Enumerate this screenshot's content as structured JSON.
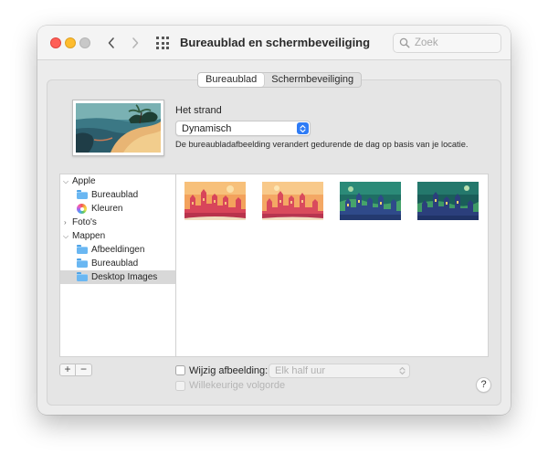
{
  "window": {
    "title": "Bureaublad en schermbeveiliging",
    "search_placeholder": "Zoek"
  },
  "tabs": [
    {
      "label": "Bureaublad",
      "active": true
    },
    {
      "label": "Schermbeveiliging",
      "active": false
    }
  ],
  "wallpaper": {
    "name": "Het strand",
    "mode": "Dynamisch",
    "description": "De bureaubladafbeelding verandert gedurende de dag op basis van je locatie."
  },
  "sidebar": {
    "groups": [
      {
        "label": "Apple",
        "expanded": true,
        "items": [
          {
            "label": "Bureaublad",
            "icon": "folder-icon"
          },
          {
            "label": "Kleuren",
            "icon": "colors-icon"
          }
        ]
      },
      {
        "label": "Foto's",
        "expanded": false,
        "items": []
      },
      {
        "label": "Mappen",
        "expanded": true,
        "items": [
          {
            "label": "Afbeeldingen",
            "icon": "folder-icon"
          },
          {
            "label": "Bureaublad",
            "icon": "folder-icon"
          },
          {
            "label": "Desktop Images",
            "icon": "folder-icon",
            "selected": true
          }
        ]
      }
    ]
  },
  "thumbnails": [
    {
      "name": "castle-orange-1",
      "theme": "orange"
    },
    {
      "name": "castle-orange-2",
      "theme": "orange"
    },
    {
      "name": "castle-green-1",
      "theme": "green"
    },
    {
      "name": "castle-green-2",
      "theme": "green"
    }
  ],
  "controls": {
    "add_label": "+",
    "remove_label": "−",
    "change_picture_label": "Wijzig afbeelding:",
    "interval_value": "Elk half uur",
    "random_order_label": "Willekeurige volgorde",
    "help_label": "?"
  },
  "colors": {
    "accent": "#2f7cf6",
    "close": "#fe5f57",
    "minimize": "#febc2e",
    "folder": "#6ab7f2"
  }
}
